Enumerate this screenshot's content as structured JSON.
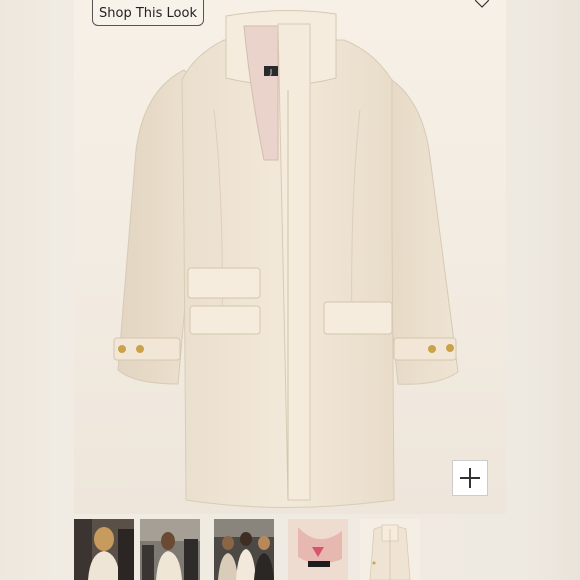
{
  "toolbar": {
    "shop_label": "Shop This Look"
  },
  "icons": {
    "like": "heart-icon",
    "zoom": "plus-icon"
  },
  "product": {
    "label_tag": "J"
  },
  "thumbnails": [
    {
      "name": "street-style-photo-1"
    },
    {
      "name": "street-style-photo-2"
    },
    {
      "name": "street-style-photo-3"
    },
    {
      "name": "coat-lining-detail"
    },
    {
      "name": "coat-front-product-shot"
    }
  ],
  "colors": {
    "coat": "#f1e6d6",
    "background": "#f4eee5",
    "button_gold": "#c9a24a"
  }
}
